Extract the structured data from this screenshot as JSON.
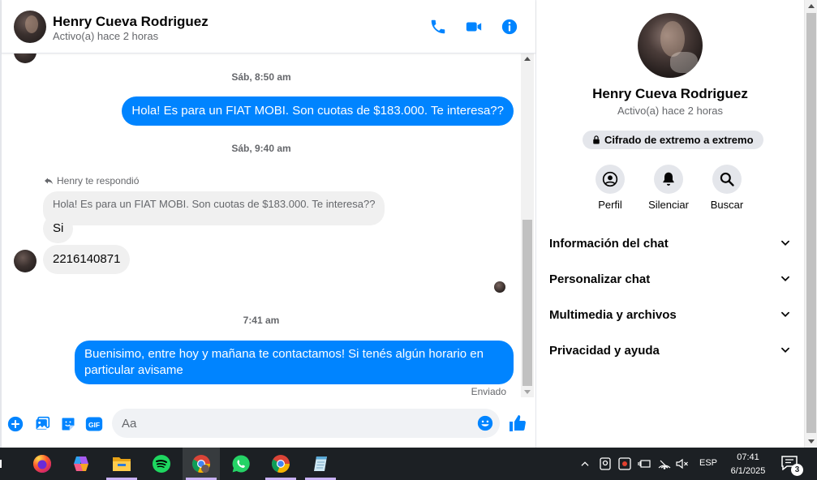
{
  "header": {
    "name": "Henry Cueva Rodriguez",
    "status": "Activo(a) hace 2 horas"
  },
  "messages": {
    "timestamp_1": "Sáb, 8:50 am",
    "out_1": "Hola! Es para un FIAT MOBI. Son cuotas de $183.000. Te interesa??",
    "timestamp_2": "Sáb, 9:40 am",
    "reply_label": "Henry te respondió",
    "quoted": "Hola! Es para un FIAT MOBI. Son cuotas de $183.000. Te interesa??",
    "in_1": "Si",
    "in_2": "2216140871",
    "timestamp_3": "7:41 am",
    "out_2": "Buenisimo, entre hoy y mañana te contactamos! Si tenés algún horario en particular avisame",
    "sent_status": "Enviado"
  },
  "composer": {
    "placeholder": "Aa"
  },
  "info": {
    "name": "Henry Cueva Rodriguez",
    "status": "Activo(a) hace 2 horas",
    "e2e": "Cifrado de extremo a extremo",
    "actions": [
      {
        "label": "Perfil",
        "icon": "profile-icon"
      },
      {
        "label": "Silenciar",
        "icon": "bell-icon"
      },
      {
        "label": "Buscar",
        "icon": "search-icon"
      }
    ],
    "sections": [
      {
        "label": "Información del chat"
      },
      {
        "label": "Personalizar chat"
      },
      {
        "label": "Multimedia y archivos"
      },
      {
        "label": "Privacidad y ayuda"
      }
    ]
  },
  "taskbar": {
    "lang": "ESP",
    "time": "07:41",
    "date": "6/1/2025",
    "notifications": "3"
  },
  "colors": {
    "accent": "#0084ff",
    "bubble_in": "#f0f0f0",
    "taskbar": "#1c2024"
  }
}
